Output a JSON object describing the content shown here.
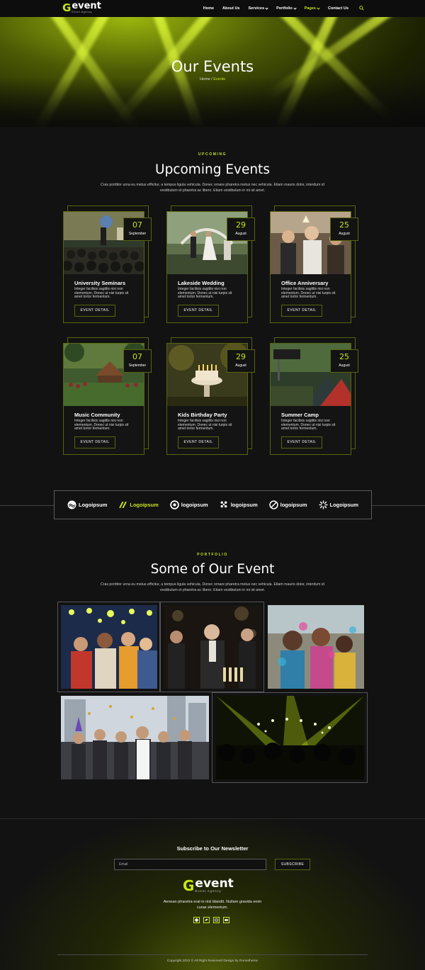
{
  "nav": {
    "logo_mark": "G",
    "logo_word": "event",
    "logo_tagline": "Event Agency",
    "items": [
      {
        "label": "Home",
        "has_dropdown": false,
        "active": false
      },
      {
        "label": "About Us",
        "has_dropdown": false,
        "active": false
      },
      {
        "label": "Services",
        "has_dropdown": true,
        "active": false
      },
      {
        "label": "Portfolio",
        "has_dropdown": true,
        "active": false
      },
      {
        "label": "Pages",
        "has_dropdown": true,
        "active": true
      },
      {
        "label": "Contact Us",
        "has_dropdown": false,
        "active": false
      }
    ],
    "search_icon": "search-icon"
  },
  "hero": {
    "title": "Our Events",
    "breadcrumb_home": "Home",
    "breadcrumb_sep": " / ",
    "breadcrumb_current": "Events"
  },
  "upcoming": {
    "eyebrow": "UPCOMING",
    "title": "Upcoming Events",
    "text": "Cras porttitor urna eu metus efficitur, a tempus ligula vehicula. Donec ornare pharetra metus nec vehicula. Etiam mauris dolor, interdum id vestibulum et pharetra ac libero. Etiam vestibulum in mi sit amet.",
    "button_label": "EVENT DETAIL",
    "events": [
      {
        "day": "07",
        "month": "September",
        "title": "University Seminars",
        "desc": "Integer facilisis sagittis nisi non elementum. Donec ut nisi turpis sit amet tortor fermentum."
      },
      {
        "day": "29",
        "month": "August",
        "title": "Lakeside Wedding",
        "desc": "Integer facilisis sagittis nisi non elementum. Donec ut nisi turpis sit amet tortor fermentum."
      },
      {
        "day": "25",
        "month": "August",
        "title": "Office Anniversary",
        "desc": "Integer facilisis sagittis nisi non elementum. Donec ut nisi turpis sit amet tortor fermentum."
      },
      {
        "day": "07",
        "month": "September",
        "title": "Music Community",
        "desc": "Integer facilisis sagittis nisi non elementum. Donec ut nisi turpis sit amet tortor fermentum."
      },
      {
        "day": "29",
        "month": "August",
        "title": "Kids Birthday Party",
        "desc": "Integer facilisis sagittis nisi non elementum. Donec ut nisi turpis sit amet tortor fermentum."
      },
      {
        "day": "25",
        "month": "August",
        "title": "Summer Camp",
        "desc": "Integer facilisis sagittis nisi non elementum. Donec ut nisi turpis sit amet tortor fermentum."
      }
    ]
  },
  "partners": [
    {
      "label": "Logoipsum",
      "icon": "circle-waves-icon",
      "highlight": false
    },
    {
      "label": "Logoipsum",
      "icon": "chevrons-icon",
      "highlight": true
    },
    {
      "label": "logoipsum",
      "icon": "ring-icon",
      "highlight": false
    },
    {
      "label": "logoipsum",
      "icon": "dots-icon",
      "highlight": false
    },
    {
      "label": "logoipsum",
      "icon": "slash-circle-icon",
      "highlight": false
    },
    {
      "label": "Logoipsum",
      "icon": "burst-icon",
      "highlight": false
    }
  ],
  "portfolio": {
    "eyebrow": "PORTFOLIO",
    "title": "Some of Our Event",
    "text": "Cras porttitor urna eu metus efficitur, a tempus ligula vehicula. Donec ornare pharetra metus nec vehicula. Etiam mauris dolor, interdum id vestibulum et pharetra ac libero. Etiam vestibulum in mi sit amet."
  },
  "footer": {
    "newsletter_title": "Subscribe to Our Newsletter",
    "email_placeholder": "Email",
    "subscribe_label": "SUBSCRIBE",
    "text": "Aenean pharetra erat in nisl blandit. Nullam gravida enim curae elementum.",
    "social": [
      "facebook-icon",
      "twitter-icon",
      "instagram-icon",
      "youtube-icon"
    ],
    "copyright": "Copyright 2022 © All Right Reserved Design by Rometheme"
  },
  "colors": {
    "accent": "#c6e31a",
    "background": "#121212",
    "border": "#58650e"
  }
}
